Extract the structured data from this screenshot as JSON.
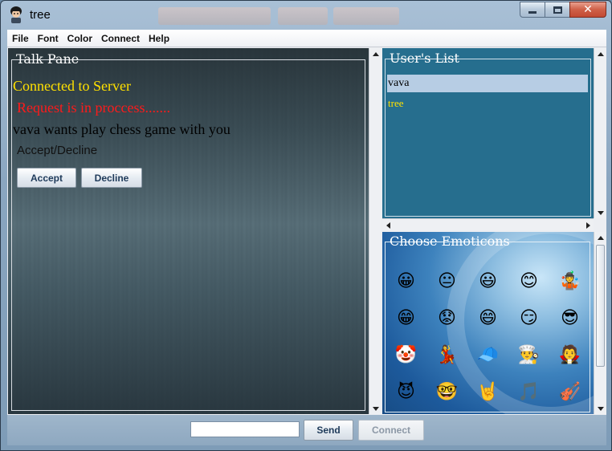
{
  "window": {
    "title": "tree",
    "controls": {
      "minimize": "minimize",
      "maximize": "maximize",
      "close": "✕"
    }
  },
  "menu": [
    "File",
    "Font",
    "Color",
    "Connect",
    "Help"
  ],
  "talk_pane": {
    "legend": "Talk Pane",
    "messages": {
      "connected": "Connected to Server",
      "request": "Request is in proccess.......",
      "invite": "vava wants play chess game with you",
      "prompt": "Accept/Decline"
    },
    "accept_label": "Accept",
    "decline_label": "Decline"
  },
  "users": {
    "legend": "User's List",
    "items": [
      "vava",
      "tree"
    ],
    "selected": "vava"
  },
  "emoticons": {
    "legend": "Choose Emoticons",
    "icons": [
      "😀",
      "😐",
      "😃",
      "😊",
      "🤹",
      "😁",
      "😟",
      "😄",
      "😏",
      "😎",
      "🤡",
      "💃",
      "🧢",
      "👨‍🍳",
      "🧛",
      "😈",
      "🤓",
      "🤘",
      "🎵",
      "🎻"
    ]
  },
  "bottom": {
    "message_value": "",
    "send_label": "Send",
    "connect_label": "Connect"
  },
  "colors": {
    "talk_text_yellow": "#ffe000",
    "talk_text_red": "#ff1a1a",
    "users_bg": "#266e8e",
    "selection": "#b7cde4"
  }
}
